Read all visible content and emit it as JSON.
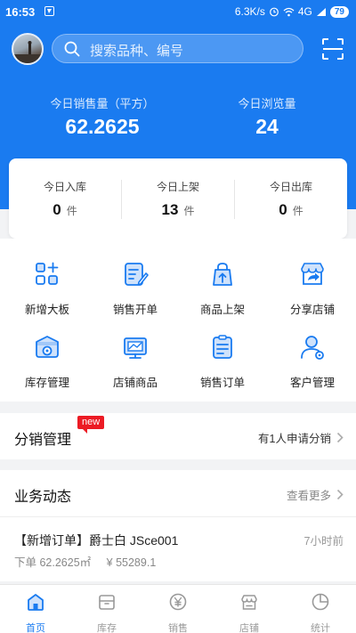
{
  "status_bar": {
    "time": "16:53",
    "network_speed": "6.3K/s",
    "signal": "4G",
    "battery": "79"
  },
  "header": {
    "search_placeholder": "搜索品种、编号",
    "sales_label": "今日销售量（平方）",
    "sales_value": "62.2625",
    "views_label": "今日浏览量",
    "views_value": "24"
  },
  "daily_stats": [
    {
      "label": "今日入库",
      "value": "0",
      "unit": "件"
    },
    {
      "label": "今日上架",
      "value": "13",
      "unit": "件"
    },
    {
      "label": "今日出库",
      "value": "0",
      "unit": "件"
    }
  ],
  "menu_items": [
    {
      "label": "新增大板",
      "icon": "grid-plus-icon"
    },
    {
      "label": "销售开单",
      "icon": "sales-order-edit-icon"
    },
    {
      "label": "商品上架",
      "icon": "bag-upload-icon"
    },
    {
      "label": "分享店铺",
      "icon": "store-share-icon"
    },
    {
      "label": "库存管理",
      "icon": "inventory-settings-icon"
    },
    {
      "label": "店铺商品",
      "icon": "store-products-icon"
    },
    {
      "label": "销售订单",
      "icon": "order-list-icon"
    },
    {
      "label": "客户管理",
      "icon": "customer-settings-icon"
    }
  ],
  "distribution": {
    "title": "分销管理",
    "badge": "new",
    "request_text": "有1人申请分销"
  },
  "business": {
    "title": "业务动态",
    "more_label": "查看更多",
    "latest": {
      "title": "【新增订单】爵士白 JSce001",
      "time": "7小时前",
      "quantity": "下单 62.2625㎡",
      "amount": "¥ 55289.1"
    }
  },
  "tabs": [
    {
      "label": "首页",
      "icon": "home-icon",
      "active": true
    },
    {
      "label": "库存",
      "icon": "inventory-icon",
      "active": false
    },
    {
      "label": "销售",
      "icon": "yen-icon",
      "active": false
    },
    {
      "label": "店铺",
      "icon": "store-icon",
      "active": false
    },
    {
      "label": "统计",
      "icon": "pie-chart-icon",
      "active": false
    }
  ],
  "colors": {
    "brand": "#1a7bf0",
    "icon_blue": "#1a7bf0",
    "icon_light": "#cfe2fb",
    "badge_red": "#ec1b24"
  }
}
